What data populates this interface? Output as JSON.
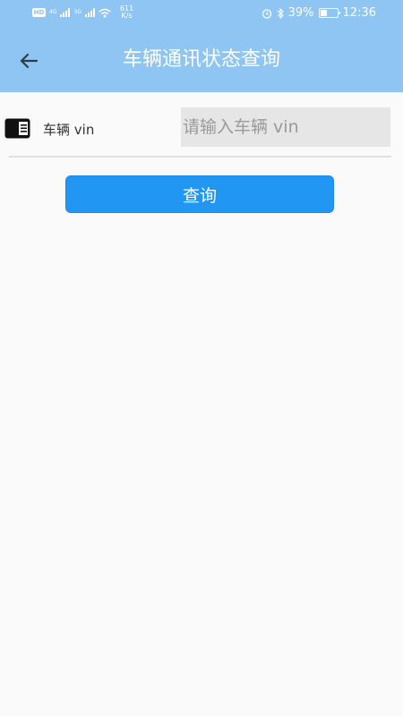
{
  "status_bar": {
    "hd_badge": "HD",
    "sim1_net": "4G",
    "sim2_net": "3G",
    "speed_value": "611",
    "speed_unit": "K/s",
    "battery_percent": "39%",
    "time": "12:36",
    "icons": [
      "alarm-icon",
      "bluetooth-icon",
      "battery-icon",
      "wifi-icon",
      "signal-icon"
    ]
  },
  "app_bar": {
    "title": "车辆通讯状态查询",
    "back_icon": "arrow-left-icon"
  },
  "form": {
    "vin_label": "车辆 vin",
    "vin_placeholder": "请输入车辆 vin",
    "vin_value": "",
    "vin_icon": "card-icon"
  },
  "actions": {
    "query_label": "查询"
  },
  "colors": {
    "app_bar": "#8ec5f3",
    "button": "#2196f3",
    "background": "#fafafa",
    "input_bg": "#e6e6e6"
  }
}
